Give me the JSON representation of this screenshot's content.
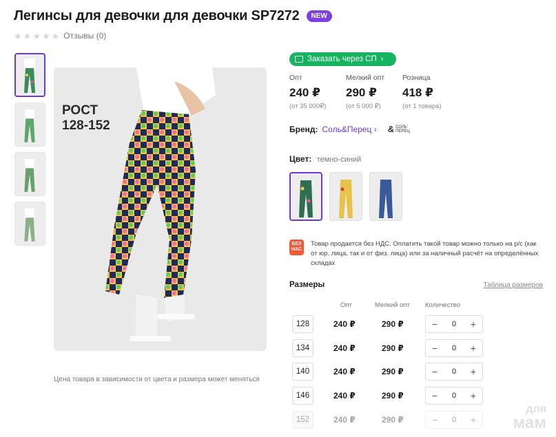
{
  "product": {
    "title": "Легинсы для девочки для девочки SP7272",
    "badge": "NEW",
    "reviews_label": "Отзывы (0)",
    "rating": 0,
    "image_note": "Цена товара в зависимости от цвета и размера может меняться",
    "image_overlay": "РОСТ 128-152"
  },
  "sp_button": {
    "label": "Заказать через СП",
    "icon": "cart-icon",
    "color": "#16b361"
  },
  "prices": [
    {
      "label": "Опт",
      "value": "240 ₽",
      "sub": "(от 35 000₽)"
    },
    {
      "label": "Мелкий опт",
      "value": "290 ₽",
      "sub": "(от 5 000 ₽)"
    },
    {
      "label": "Розница",
      "value": "418 ₽",
      "sub": "(от 1 товара)"
    }
  ],
  "brand": {
    "label": "Бренд:",
    "name": "Соль&Перец",
    "logo_text": "СОЛЬ' ПЕРЕЦ"
  },
  "color": {
    "label": "Цвет:",
    "value": "темно-синий"
  },
  "vat_notice": {
    "icon_text": "БЕЗ НАС",
    "text": "Товар продается без НДС. Оплатить такой товар можно только на р/с (как от юр. лица, так и от физ. лица) или за наличный расчёт на определённых складах"
  },
  "sizes": {
    "title": "Размеры",
    "table_link": "Таблица размеров",
    "headers": {
      "opt": "Опт",
      "small": "Мелкий опт",
      "qty": "Количество"
    },
    "rows": [
      {
        "size": "128",
        "opt": "240 ₽",
        "small": "290 ₽",
        "qty": "0",
        "disabled": false
      },
      {
        "size": "134",
        "opt": "240 ₽",
        "small": "290 ₽",
        "qty": "0",
        "disabled": false
      },
      {
        "size": "140",
        "opt": "240 ₽",
        "small": "290 ₽",
        "qty": "0",
        "disabled": false
      },
      {
        "size": "146",
        "opt": "240 ₽",
        "small": "290 ₽",
        "qty": "0",
        "disabled": false
      },
      {
        "size": "152",
        "opt": "240 ₽",
        "small": "290 ₽",
        "qty": "0",
        "disabled": true
      }
    ]
  },
  "watermark": {
    "line1": "для",
    "line2": "мам"
  },
  "accent_color": "#6d39d8"
}
